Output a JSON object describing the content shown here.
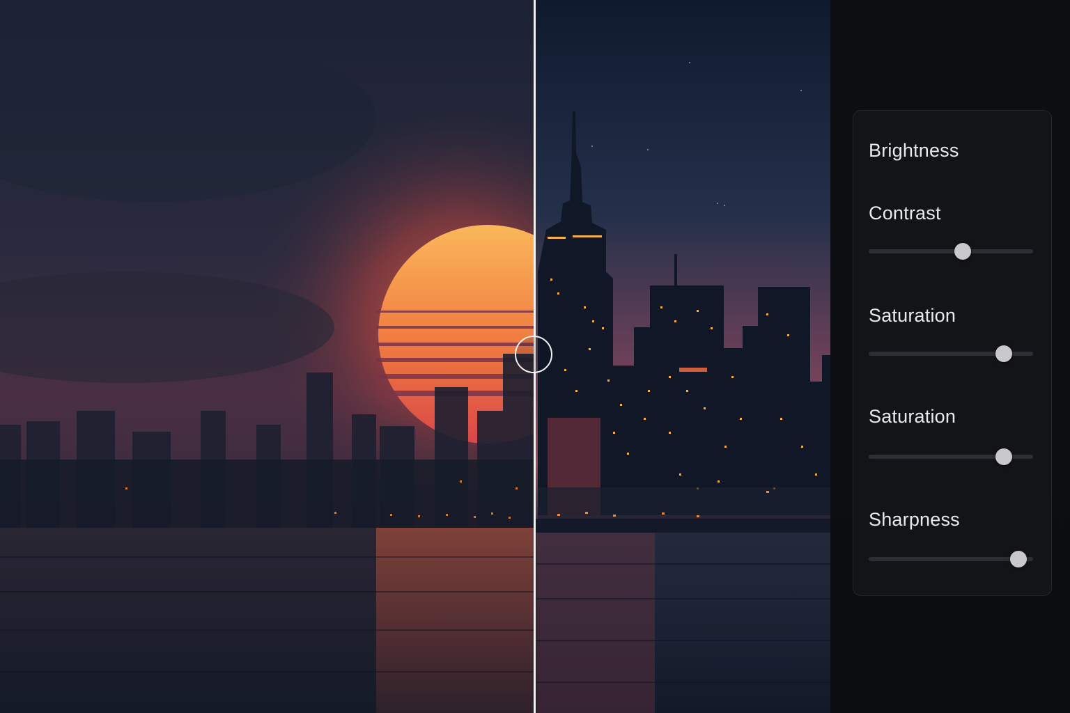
{
  "compare": {
    "divider_position_pct": 50
  },
  "adjustments": [
    {
      "label": "Brightness"
    },
    {
      "label": "Contrast",
      "value_pct": 57
    },
    {
      "label": "Saturation",
      "value_pct": 82
    },
    {
      "label": "Saturation",
      "value_pct": 82
    },
    {
      "label": "Sharpness",
      "value_pct": 91
    }
  ],
  "colors": {
    "panel_bg": "#121417",
    "slider_track": "#2b2e33",
    "slider_thumb": "#c9c9cb",
    "sun": "#f59a45",
    "window_lights": "#f4b04a"
  }
}
